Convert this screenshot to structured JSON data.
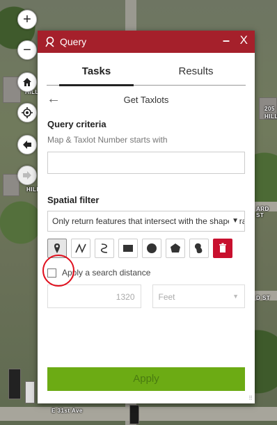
{
  "map": {
    "labels": [
      "205",
      "HILL",
      "ARD ST",
      "D ST",
      "HILL",
      "HILL",
      "E 31st Ave"
    ]
  },
  "map_controls": {
    "zoom_in": "+",
    "zoom_out": "−",
    "home": "home-icon",
    "locate": "locate-icon",
    "back": "arrow-left-icon",
    "forward": "arrow-right-icon"
  },
  "panel": {
    "title": "Query",
    "minimize": "–",
    "close": "X",
    "tabs": [
      "Tasks",
      "Results"
    ],
    "task_name": "Get Taxlots",
    "query_criteria": {
      "heading": "Query criteria",
      "hint": "Map & Taxlot Number starts with",
      "value": ""
    },
    "spatial_filter": {
      "heading": "Spatial filter",
      "selected_option": "Only return features that intersect with the shape drawn on the map",
      "tools": [
        "point",
        "polyline",
        "freehand-polyline",
        "rectangle",
        "circle",
        "polygon",
        "freehand-polygon",
        "clear"
      ]
    },
    "search_distance": {
      "label": "Apply a search distance",
      "checked": false,
      "value": "1320",
      "unit": "Feet"
    },
    "apply_label": "Apply"
  },
  "colors": {
    "title_bar": "#a5202b",
    "apply_button": "#6cab14",
    "delete_button": "#c8102e",
    "highlight_ring": "#e0101e"
  }
}
